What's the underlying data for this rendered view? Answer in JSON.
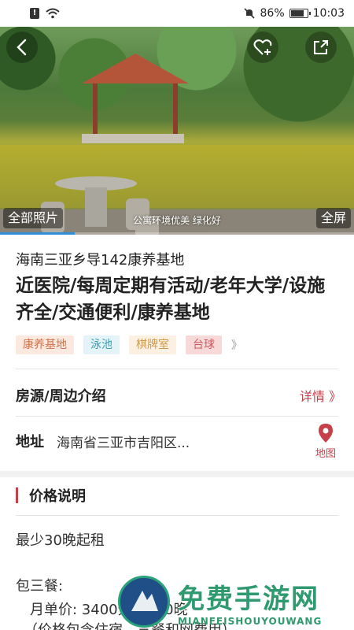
{
  "status_bar": {
    "battery": "86%",
    "time": "10:03"
  },
  "hero": {
    "caption": "公寓环境优美 绿化好",
    "all_photos_label": "全部照片",
    "fullscreen_label": "全屏",
    "progress": 0.21
  },
  "listing": {
    "location": "海南三亚乡导142康养基地",
    "title": "近医院/每周定期有活动/老年大学/设施齐全/交通便利/康养基地",
    "tags": [
      "康养基地",
      "泳池",
      "棋牌室",
      "台球"
    ],
    "more_tags_symbol": "》"
  },
  "intro_row": {
    "label": "房源/周边介绍",
    "detail_link": "详情 》"
  },
  "address_row": {
    "label": "地址",
    "text": "海南省三亚市吉阳区...",
    "map_label": "地图"
  },
  "price": {
    "section_title": "价格说明",
    "min_nights": "最少30晚起租",
    "meals": "包三餐:",
    "monthly": "月单价: 3400元/人/30晚",
    "includes": "（价格包含住宿、三餐和网费用）"
  },
  "watermark": {
    "main": "免费手游网",
    "sub": "MIANFEISHOUYOUWANG"
  },
  "colors": {
    "accent_red": "#c6404a",
    "progress_blue": "#2f8fd8"
  }
}
